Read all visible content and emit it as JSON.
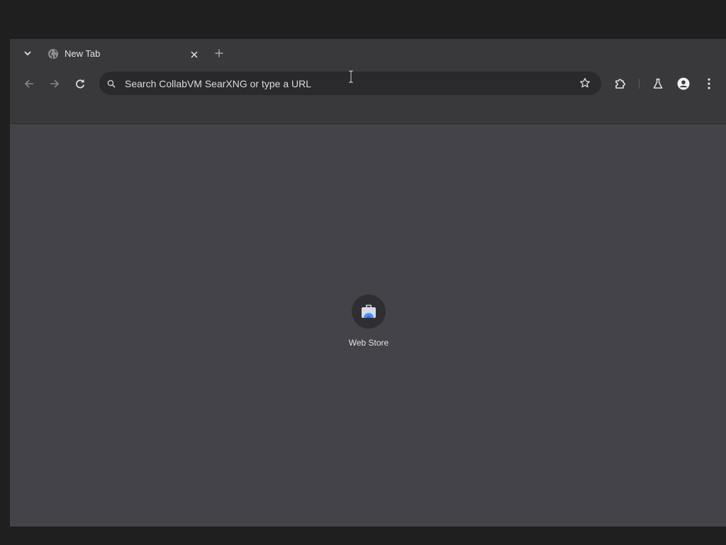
{
  "browser": {
    "tabs": [
      {
        "title": "New Tab",
        "favicon": "globe-icon",
        "active": true
      }
    ],
    "tab_search_icon": "chevron-down-icon",
    "close_tab_icon": "close-icon",
    "new_tab_icon": "plus-icon"
  },
  "toolbar": {
    "back_icon": "arrow-left-icon",
    "forward_icon": "arrow-right-icon",
    "reload_icon": "reload-icon",
    "omnibox": {
      "value": "",
      "placeholder": "Search CollabVM SearXNG or type a URL",
      "search_icon": "search-icon",
      "bookmark_icon": "star-outline-icon"
    },
    "extensions_icon": "puzzle-icon",
    "labs_icon": "flask-icon",
    "profile_icon": "person-icon",
    "menu_icon": "kebab-menu-icon"
  },
  "new_tab_page": {
    "shortcuts": [
      {
        "label": "Web Store",
        "icon": "web-store-icon"
      }
    ]
  },
  "colors": {
    "desktop": "#1f1f20",
    "frame": "#39393c",
    "content": "#434349",
    "omnibox": "#2a2a2d",
    "text": "#e3e3e3",
    "accent_blue": "#4c8df6"
  }
}
